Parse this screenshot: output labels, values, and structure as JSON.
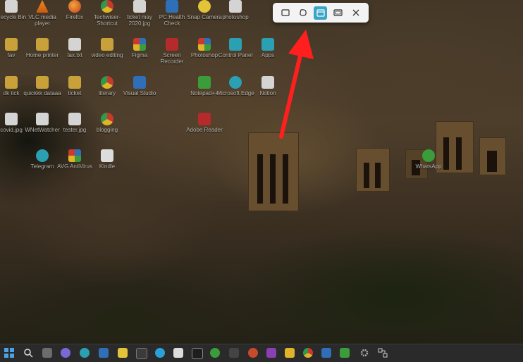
{
  "desktop": {
    "icons": [
      {
        "label": "Recycle Bin",
        "glyph": "recycle-bin-icon"
      },
      {
        "label": "VLC media player",
        "glyph": "vlc-icon"
      },
      {
        "label": "Firefox",
        "glyph": "firefox-icon"
      },
      {
        "label": "Techwiser-Shortcut",
        "glyph": "chrome-icon"
      },
      {
        "label": "ticket may 2020.jpg",
        "glyph": "image-file-icon"
      },
      {
        "label": "PC Health Check",
        "glyph": "pc-health-icon"
      },
      {
        "label": "Snap Camera",
        "glyph": "snap-camera-icon"
      },
      {
        "label": "photoshop",
        "glyph": "document-icon"
      },
      {
        "label": "fav",
        "glyph": "folder-icon"
      },
      {
        "label": "Home printer",
        "glyph": "folder-icon"
      },
      {
        "label": "tax.txt",
        "glyph": "text-file-icon"
      },
      {
        "label": "video editing",
        "glyph": "folder-icon"
      },
      {
        "label": "Figma",
        "glyph": "figma-icon"
      },
      {
        "label": "Screen Recorder",
        "glyph": "app-icon"
      },
      {
        "label": "Photoshop",
        "glyph": "app-icon"
      },
      {
        "label": "Control Panel",
        "glyph": "control-panel-icon"
      },
      {
        "label": "Apps",
        "glyph": "app-icon"
      },
      {
        "label": "dk tick",
        "glyph": "folder-icon"
      },
      {
        "label": "quickkk dataaa",
        "glyph": "folder-icon"
      },
      {
        "label": "ticket",
        "glyph": "folder-icon"
      },
      {
        "label": "literary",
        "glyph": "chrome-icon"
      },
      {
        "label": "Visual Studio",
        "glyph": "app-icon"
      },
      {
        "label": "Notepad++",
        "glyph": "app-icon"
      },
      {
        "label": "Microsoft Edge",
        "glyph": "edge-icon"
      },
      {
        "label": "Notion",
        "glyph": "notion-icon"
      },
      {
        "label": "covid.jpg",
        "glyph": "image-file-icon"
      },
      {
        "label": "WNetWatcher",
        "glyph": "document-icon"
      },
      {
        "label": "tester.jpg",
        "glyph": "image-file-icon"
      },
      {
        "label": "blogging",
        "glyph": "chrome-icon"
      },
      {
        "label": "Adobe Reader",
        "glyph": "app-icon"
      },
      {
        "label": "Telegram",
        "glyph": "telegram-icon"
      },
      {
        "label": "AVG AntiVirus",
        "glyph": "avg-icon"
      },
      {
        "label": "Kindle",
        "glyph": "kindle-icon"
      },
      {
        "label": "WhatsApp",
        "glyph": "whatsapp-icon"
      }
    ]
  },
  "snip_toolbar": {
    "buttons": [
      {
        "name": "rectangle-mode-icon",
        "active": false
      },
      {
        "name": "freeform-mode-icon",
        "active": false
      },
      {
        "name": "window-mode-icon",
        "active": true
      },
      {
        "name": "fullscreen-mode-icon",
        "active": false
      },
      {
        "name": "close-icon",
        "active": false
      }
    ]
  },
  "colors": {
    "arrow": "#ff1f1f",
    "active_mode": "#3aa6c7",
    "taskbar": "#2a2a2a"
  },
  "taskbar": {
    "items": [
      "windows-start-icon",
      "search-icon",
      "task-view-icon",
      "chat-icon",
      "edge-icon",
      "monitor-icon",
      "sticky-notes-icon",
      "app-icon",
      "telegram-icon",
      "kindle-icon",
      "app-icon",
      "whatsapp-icon",
      "app-icon",
      "onenote-icon",
      "file-explorer-icon",
      "chrome-icon",
      "outlook-icon",
      "app-icon",
      "settings-icon",
      "network-icon"
    ]
  }
}
